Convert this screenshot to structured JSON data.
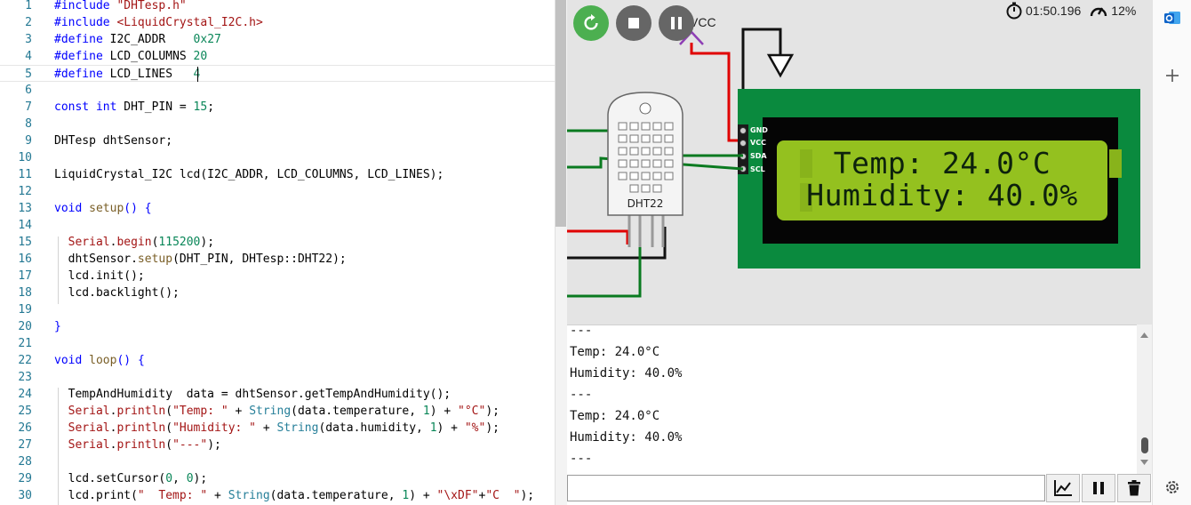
{
  "editor": {
    "lines": [
      {
        "n": "1",
        "html": "<span class=\"k\">#include</span> <span class=\"s\">\"DHTesp.h\"</span>"
      },
      {
        "n": "2",
        "html": "<span class=\"k\">#include</span> <span class=\"s\">&lt;LiquidCrystal_I2C.h&gt;</span>"
      },
      {
        "n": "3",
        "html": "<span class=\"k\">#define</span> I2C_ADDR    <span class=\"n\">0x27</span>"
      },
      {
        "n": "4",
        "html": "<span class=\"k\">#define</span> LCD_COLUMNS <span class=\"n\">20</span>"
      },
      {
        "n": "5",
        "html": "<span class=\"k\">#define</span> LCD_LINES   <span class=\"n\">4</span>"
      },
      {
        "n": "6",
        "html": ""
      },
      {
        "n": "7",
        "html": "<span class=\"k\">const</span> <span class=\"k\">int</span> DHT_PIN = <span class=\"n\">15</span>;"
      },
      {
        "n": "8",
        "html": ""
      },
      {
        "n": "9",
        "html": "DHTesp dhtSensor;"
      },
      {
        "n": "10",
        "html": ""
      },
      {
        "n": "11",
        "html": "LiquidCrystal_I2C lcd(I2C_ADDR, LCD_COLUMNS, LCD_LINES);"
      },
      {
        "n": "12",
        "html": ""
      },
      {
        "n": "13",
        "html": "<span class=\"k\">void</span> <span class=\"f\">setup</span><span class=\"k\">()</span> <span class=\"k\">{</span>"
      },
      {
        "n": "14",
        "html": ""
      },
      {
        "n": "15",
        "html": "  <span class=\"s\">Serial</span>.<span class=\"s\">begin</span>(<span class=\"n\">115200</span>);"
      },
      {
        "n": "16",
        "html": "  dhtSensor.<span class=\"f\">setup</span>(DHT_PIN, DHTesp::DHT22);"
      },
      {
        "n": "17",
        "html": "  lcd.init();"
      },
      {
        "n": "18",
        "html": "  lcd.backlight();"
      },
      {
        "n": "19",
        "html": ""
      },
      {
        "n": "20",
        "html": "<span class=\"k\">}</span>"
      },
      {
        "n": "21",
        "html": ""
      },
      {
        "n": "22",
        "html": "<span class=\"k\">void</span> <span class=\"f\">loop</span><span class=\"k\">()</span> <span class=\"k\">{</span>"
      },
      {
        "n": "23",
        "html": ""
      },
      {
        "n": "24",
        "html": "  TempAndHumidity  data = dhtSensor.getTempAndHumidity();"
      },
      {
        "n": "25",
        "html": "  <span class=\"s\">Serial</span>.<span class=\"s\">println</span>(<span class=\"s\">\"Temp: \"</span> + <span class=\"c\">String</span>(data.temperature, <span class=\"n\">1</span>) + <span class=\"s\">\"°C\"</span>);"
      },
      {
        "n": "26",
        "html": "  <span class=\"s\">Serial</span>.<span class=\"s\">println</span>(<span class=\"s\">\"Humidity: \"</span> + <span class=\"c\">String</span>(data.humidity, <span class=\"n\">1</span>) + <span class=\"s\">\"%\"</span>);"
      },
      {
        "n": "27",
        "html": "  <span class=\"s\">Serial</span>.<span class=\"s\">println</span>(<span class=\"s\">\"---\"</span>);"
      },
      {
        "n": "28",
        "html": ""
      },
      {
        "n": "29",
        "html": "  lcd.setCursor(<span class=\"n\">0</span>, <span class=\"n\">0</span>);"
      },
      {
        "n": "30",
        "html": "  lcd.print(<span class=\"s\">\"  Temp: \"</span> + <span class=\"c\">String</span>(data.temperature, <span class=\"n\">1</span>) + <span class=\"s\">\"\\xDF\"</span>+<span class=\"s\">\"C  \"</span>);"
      }
    ]
  },
  "sim": {
    "timer": "01:50.196",
    "speed": "12%",
    "vcc_label": "VCC",
    "dht_label": "DHT22",
    "lcd": {
      "row1": "Temp: 24.0°C",
      "row2": "Humidity: 40.0%"
    },
    "pins": [
      "GND",
      "VCC",
      "SDA",
      "SCL"
    ]
  },
  "serial": {
    "lines": [
      "---",
      "Temp: 24.0°C",
      "Humidity: 40.0%",
      "---",
      "Temp: 24.0°C",
      "Humidity: 40.0%",
      "---"
    ],
    "input_value": ""
  },
  "colors": {
    "green_btn": "#4caf50",
    "gray_btn": "#666666",
    "board": "#0a8a3e",
    "lcd_bg": "#94c11f",
    "wire_red": "#e00000",
    "wire_green": "#0a7a20"
  },
  "icons": {
    "restart": "restart-icon",
    "stop": "stop-icon",
    "pause": "pause-icon",
    "chart": "chart-icon",
    "trash": "trash-icon",
    "settings": "gear-icon",
    "outlook": "outlook-icon",
    "add": "plus-icon"
  }
}
